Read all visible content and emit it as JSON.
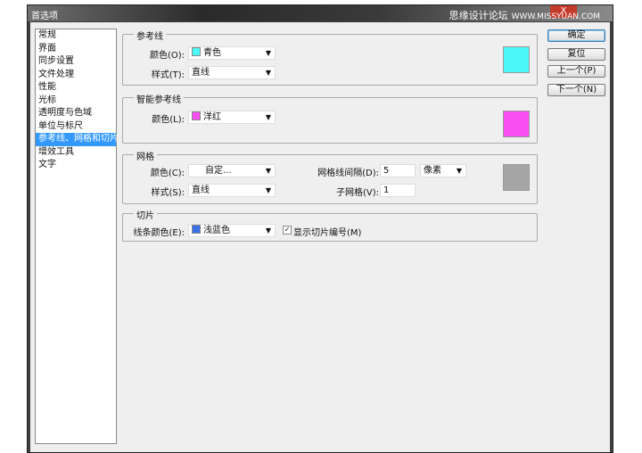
{
  "window": {
    "title": "首选项",
    "watermark": "思缘设计论坛",
    "watermark_url": "WWW.MISSYUAN.COM",
    "close": "X"
  },
  "sidebar": {
    "items": [
      {
        "label": "常规"
      },
      {
        "label": "界面"
      },
      {
        "label": "同步设置"
      },
      {
        "label": "文件处理"
      },
      {
        "label": "性能"
      },
      {
        "label": "光标"
      },
      {
        "label": "透明度与色域"
      },
      {
        "label": "单位与标尺"
      },
      {
        "label": "参考线、网格和切片",
        "selected": true
      },
      {
        "label": "增效工具"
      },
      {
        "label": "文字"
      }
    ]
  },
  "guides": {
    "title": "参考线",
    "color_label": "颜色(O):",
    "color_value": "青色",
    "color_hex": "#4ff8f8",
    "style_label": "样式(T):",
    "style_value": "直线"
  },
  "smart_guides": {
    "title": "智能参考线",
    "color_label": "颜色(L):",
    "color_value": "洋红",
    "color_hex": "#f84ff0"
  },
  "grid": {
    "title": "网格",
    "color_label": "颜色(C):",
    "color_value": "自定...",
    "color_hex": "#a6a6a6",
    "style_label": "样式(S):",
    "style_value": "直线",
    "gridline_label": "网格线间隔(D):",
    "gridline_value": "5",
    "unit_value": "像素",
    "subdiv_label": "子网格(V):",
    "subdiv_value": "1"
  },
  "slices": {
    "title": "切片",
    "color_label": "线条颜色(E):",
    "color_value": "浅蓝色",
    "color_hex": "#3a6fe8",
    "show_numbers_label": "显示切片编号(M)",
    "show_numbers_checked": true,
    "check": "✓"
  },
  "buttons": {
    "ok": "确定",
    "reset": "复位",
    "prev": "上一个(P)",
    "next": "下一个(N)"
  },
  "arrow": "▼"
}
